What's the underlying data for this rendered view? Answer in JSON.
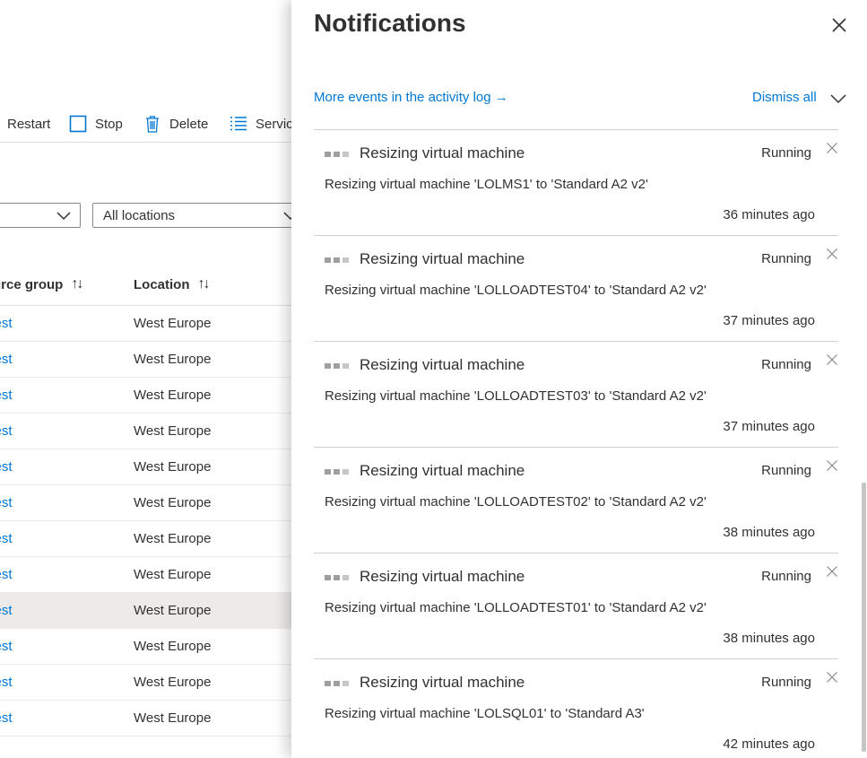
{
  "toolbar": {
    "restart_label": "Restart",
    "stop_label": "Stop",
    "delete_label": "Delete",
    "services_label": "Servic"
  },
  "filters": {
    "first_value": "",
    "location_value": "All locations"
  },
  "table": {
    "columns": [
      "urce group",
      "Location"
    ],
    "rows": [
      {
        "resource_group": "Test",
        "location": "West Europe",
        "selected": false
      },
      {
        "resource_group": "Test",
        "location": "West Europe",
        "selected": false
      },
      {
        "resource_group": "Test",
        "location": "West Europe",
        "selected": false
      },
      {
        "resource_group": "Test",
        "location": "West Europe",
        "selected": false
      },
      {
        "resource_group": "Test",
        "location": "West Europe",
        "selected": false
      },
      {
        "resource_group": "Test",
        "location": "West Europe",
        "selected": false
      },
      {
        "resource_group": "Test",
        "location": "West Europe",
        "selected": false
      },
      {
        "resource_group": "Test",
        "location": "West Europe",
        "selected": false
      },
      {
        "resource_group": "Test",
        "location": "West Europe",
        "selected": true
      },
      {
        "resource_group": "Test",
        "location": "West Europe",
        "selected": false
      },
      {
        "resource_group": "Test",
        "location": "West Europe",
        "selected": false
      },
      {
        "resource_group": "Test",
        "location": "West Europe",
        "selected": false
      }
    ]
  },
  "panel": {
    "title": "Notifications",
    "more_events_label": "More events in the activity log →",
    "dismiss_all_label": "Dismiss all",
    "notifications": [
      {
        "title": "Resizing virtual machine",
        "status": "Running",
        "description": "Resizing virtual machine 'LOLMS1' to 'Standard A2 v2'",
        "time": "36 minutes ago"
      },
      {
        "title": "Resizing virtual machine",
        "status": "Running",
        "description": "Resizing virtual machine 'LOLLOADTEST04' to 'Standard A2 v2'",
        "time": "37 minutes ago"
      },
      {
        "title": "Resizing virtual machine",
        "status": "Running",
        "description": "Resizing virtual machine 'LOLLOADTEST03' to 'Standard A2 v2'",
        "time": "37 minutes ago"
      },
      {
        "title": "Resizing virtual machine",
        "status": "Running",
        "description": "Resizing virtual machine 'LOLLOADTEST02' to 'Standard A2 v2'",
        "time": "38 minutes ago"
      },
      {
        "title": "Resizing virtual machine",
        "status": "Running",
        "description": "Resizing virtual machine 'LOLLOADTEST01' to 'Standard A2 v2'",
        "time": "38 minutes ago"
      },
      {
        "title": "Resizing virtual machine",
        "status": "Running",
        "description": "Resizing virtual machine 'LOLSQL01' to 'Standard A3'",
        "time": "42 minutes ago"
      }
    ]
  },
  "colors": {
    "accent": "#0078d4",
    "text": "#323130",
    "selected_row": "#edebe9"
  }
}
